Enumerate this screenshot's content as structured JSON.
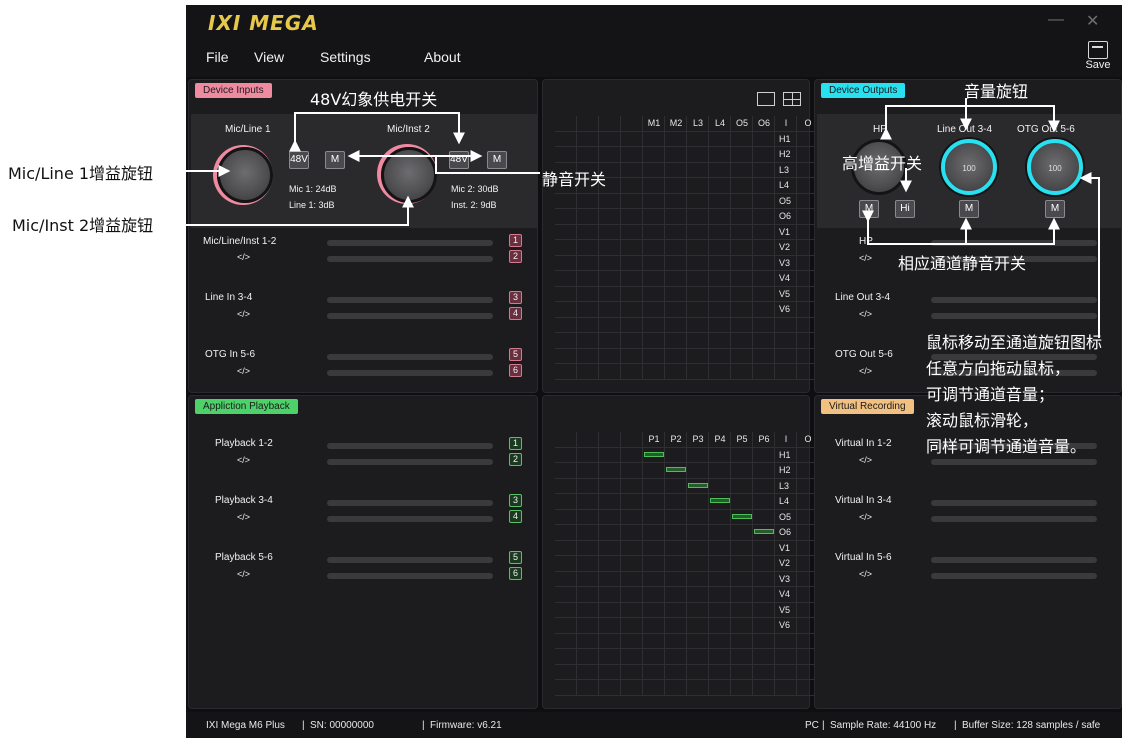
{
  "app": {
    "logo": "IXI MEGA",
    "minimize": "—",
    "close": "✕"
  },
  "menu": {
    "file": "File",
    "view": "View",
    "settings": "Settings",
    "about": "About",
    "save": "Save"
  },
  "inputs": {
    "tag": "Device Inputs",
    "mic1_title": "Mic/Line 1",
    "mic2_title": "Mic/Inst 2",
    "btn_48v_1": "48V",
    "btn_m_1": "M",
    "btn_48v_2": "48V",
    "btn_m_2": "M",
    "mic1_gain": "Mic 1:  24dB",
    "line1_gain": "Line 1:  3dB",
    "mic2_gain": "Mic 2:  30dB",
    "inst2_gain": "Inst. 2:  9dB",
    "channels": [
      {
        "label": "Mic/Line/Inst 1-2",
        "sub": "</>",
        "n1": "1",
        "n2": "2"
      },
      {
        "label": "Line In 3-4",
        "sub": "</>",
        "n1": "3",
        "n2": "4"
      },
      {
        "label": "OTG In 5-6",
        "sub": "</>",
        "n1": "5",
        "n2": "6"
      }
    ]
  },
  "outputs": {
    "tag": "Device Outputs",
    "hp_title": "HP",
    "lo_title": "Line Out 3-4",
    "otg_title": "OTG Out 5-6",
    "knob_lo_value": "100",
    "knob_otg_value": "100",
    "btn_m_hp": "M",
    "btn_hi": "Hi",
    "btn_m_lo": "M",
    "btn_m_otg": "M",
    "channels": [
      {
        "label": "HP",
        "sub": "</>"
      },
      {
        "label": "Line Out 3-4",
        "sub": "</>"
      },
      {
        "label": "OTG Out 5-6",
        "sub": "</>"
      }
    ]
  },
  "playback": {
    "tag": "Appliction Playback",
    "channels": [
      {
        "label": "Playback 1-2",
        "sub": "</>",
        "n1": "1",
        "n2": "2"
      },
      {
        "label": "Playback 3-4",
        "sub": "</>",
        "n1": "3",
        "n2": "4"
      },
      {
        "label": "Playback 5-6",
        "sub": "</>",
        "n1": "5",
        "n2": "6"
      }
    ]
  },
  "recording": {
    "tag": "Virtual Recording",
    "channels": [
      {
        "label": "Virtual In 1-2",
        "sub": "</>"
      },
      {
        "label": "Virtual In 3-4",
        "sub": "</>"
      },
      {
        "label": "Virtual In 5-6",
        "sub": "</>"
      }
    ]
  },
  "matrix_top": {
    "cols": [
      "M1",
      "M2",
      "L3",
      "L4",
      "O5",
      "O6",
      "I",
      "O"
    ],
    "rows": [
      "H1",
      "H2",
      "L3",
      "L4",
      "O5",
      "O6",
      "V1",
      "V2",
      "V3",
      "V4",
      "V5",
      "V6"
    ]
  },
  "matrix_bottom": {
    "cols": [
      "P1",
      "P2",
      "P3",
      "P4",
      "P5",
      "P6",
      "I",
      "O"
    ],
    "rows": [
      "H1",
      "H2",
      "L3",
      "L4",
      "O5",
      "O6",
      "V1",
      "V2",
      "V3",
      "V4",
      "V5",
      "V6"
    ]
  },
  "status": {
    "device": "IXI Mega M6 Plus",
    "sn": "SN: 00000000",
    "firmware": "Firmware: v6.21",
    "mode": "PC",
    "sample_rate": "Sample Rate: 44100 Hz",
    "buffer": "Buffer Size: 128 samples / safe"
  },
  "annotations": {
    "phantom": "48V幻象供电开关",
    "mute": "静音开关",
    "mic1_knob": "Mic/Line 1增益旋钮",
    "mic2_knob": "Mic/Inst 2增益旋钮",
    "volume_knob": "音量旋钮",
    "high_gain": "高增益开关",
    "channel_mute": "相应通道静音开关",
    "tip_line1": "鼠标移动至通道旋钮图标",
    "tip_line2": "任意方向拖动鼠标，",
    "tip_line3": "可调节通道音量；",
    "tip_line4": "滚动鼠标滑轮，",
    "tip_line5": "同样可调节通道音量。"
  },
  "colors": {
    "accent_pink": "#f08aa1",
    "accent_cyan": "#27e0f0",
    "accent_green": "#4dd26a",
    "accent_orange": "#f2c080",
    "logo": "#e6c84a"
  }
}
